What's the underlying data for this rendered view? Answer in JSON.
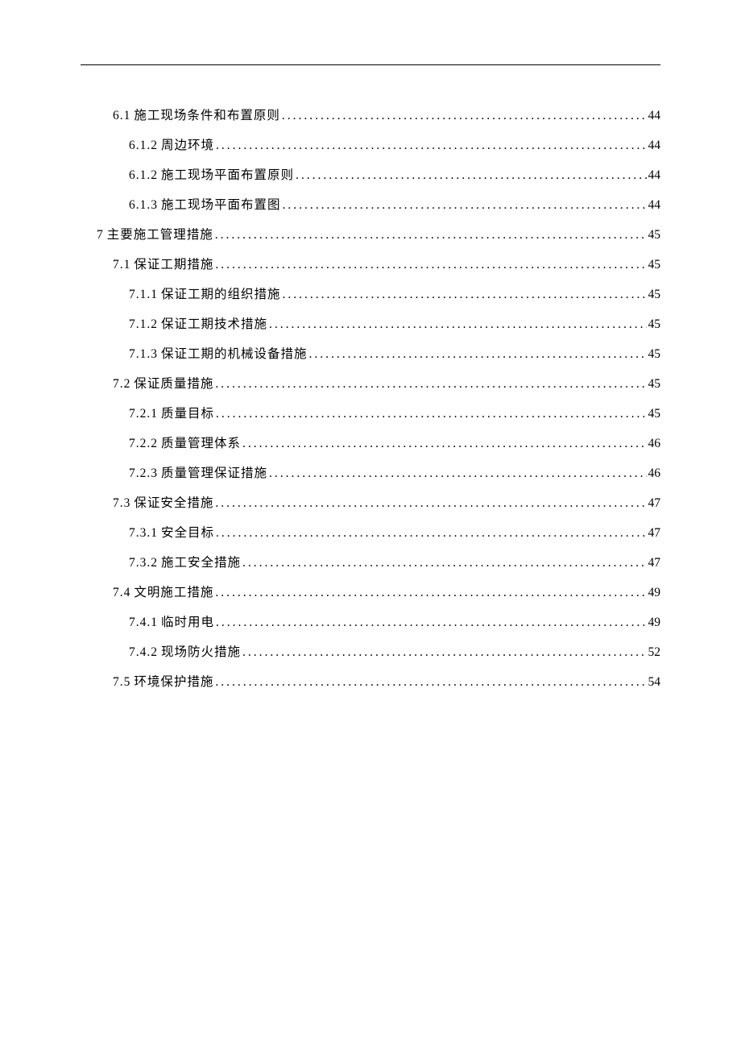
{
  "toc": [
    {
      "level": 2,
      "number": "6.1",
      "title": "施工现场条件和布置原则",
      "page": "44"
    },
    {
      "level": 3,
      "number": "6.1.2",
      "title": "周边环境",
      "page": "44"
    },
    {
      "level": 3,
      "number": "6.1.2",
      "title": "施工现场平面布置原则",
      "page": "44"
    },
    {
      "level": 3,
      "number": "6.1.3",
      "title": "施工现场平面布置图",
      "page": "44"
    },
    {
      "level": 1,
      "number": "7",
      "title": "主要施工管理措施",
      "page": "45"
    },
    {
      "level": 2,
      "number": "7.1",
      "title": "保证工期措施",
      "page": "45"
    },
    {
      "level": 3,
      "number": "7.1.1",
      "title": "保证工期的组织措施",
      "page": "45"
    },
    {
      "level": 3,
      "number": "7.1.2",
      "title": "保证工期技术措施",
      "page": "45"
    },
    {
      "level": 3,
      "number": "7.1.3",
      "title": "保证工期的机械设备措施",
      "page": "45"
    },
    {
      "level": 2,
      "number": "7.2",
      "title": "保证质量措施",
      "page": "45"
    },
    {
      "level": 3,
      "number": "7.2.1",
      "title": "质量目标",
      "page": "45"
    },
    {
      "level": 3,
      "number": "7.2.2",
      "title": "质量管理体系",
      "page": "46"
    },
    {
      "level": 3,
      "number": "7.2.3",
      "title": "质量管理保证措施",
      "page": "46"
    },
    {
      "level": 2,
      "number": "7.3",
      "title": "保证安全措施",
      "page": "47"
    },
    {
      "level": 3,
      "number": "7.3.1",
      "title": "安全目标",
      "page": "47"
    },
    {
      "level": 3,
      "number": "7.3.2",
      "title": "施工安全措施",
      "page": "47"
    },
    {
      "level": 2,
      "number": "7.4",
      "title": "文明施工措施",
      "page": "49"
    },
    {
      "level": 3,
      "number": "7.4.1",
      "title": "临时用电",
      "page": "49"
    },
    {
      "level": 3,
      "number": "7.4.2",
      "title": "现场防火措施",
      "page": "52"
    },
    {
      "level": 2,
      "number": "7.5",
      "title": "环境保护措施",
      "page": "54"
    }
  ],
  "dots": "................................................................................................................"
}
